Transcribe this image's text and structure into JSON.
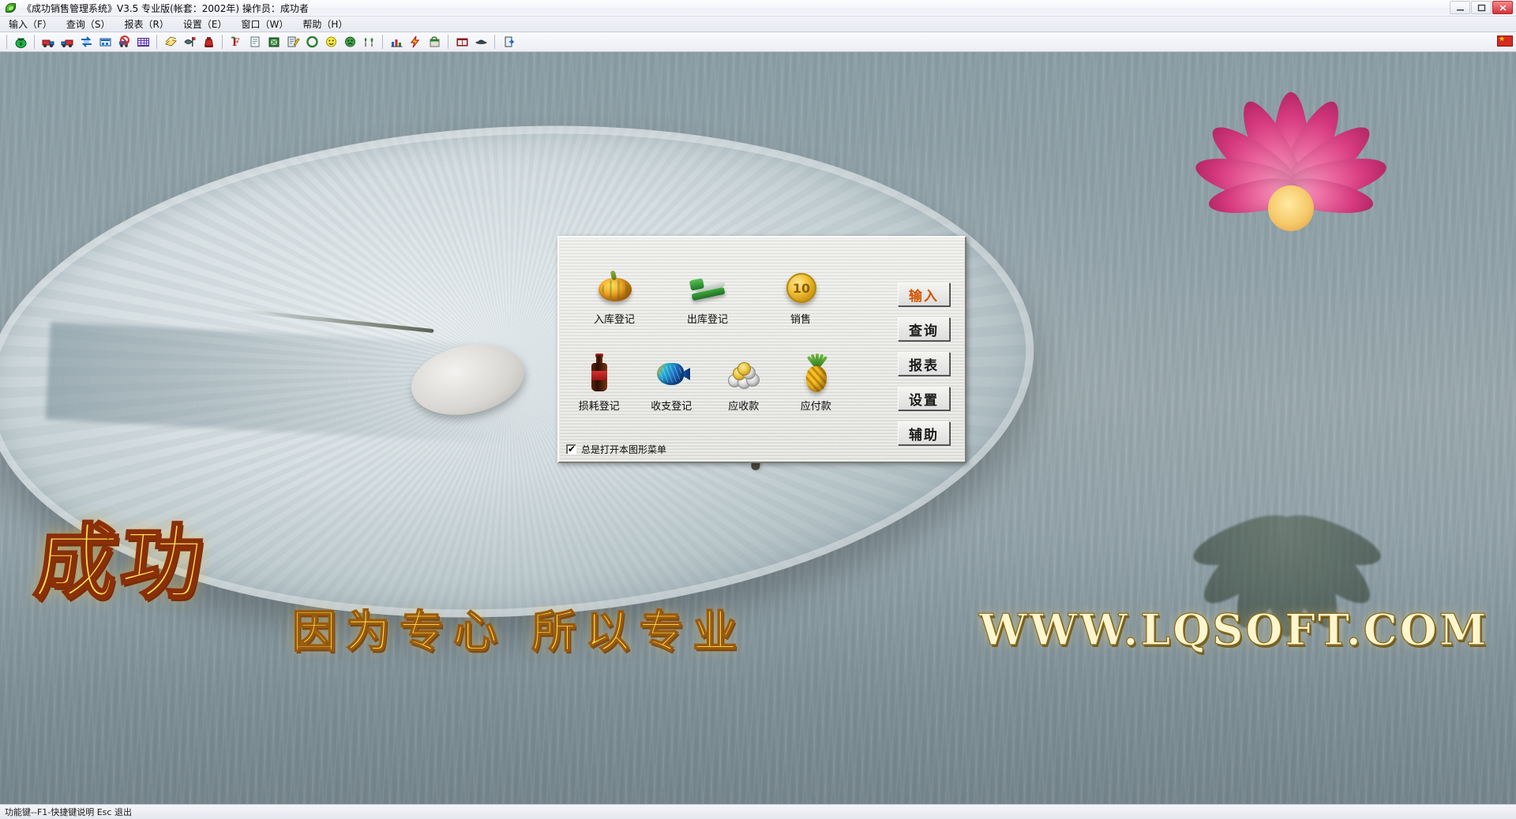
{
  "window": {
    "title": "《成功销售管理系统》V3.5 专业版(帐套：2002年) 操作员：成功者",
    "app_icon": "green-leaf-icon",
    "controls": {
      "minimize": "minimize-button",
      "maximize": "maximize-button",
      "close": "close-button"
    }
  },
  "menubar": {
    "items": [
      {
        "label": "输入（F）",
        "name": "menu-input"
      },
      {
        "label": "查询（S）",
        "name": "menu-query"
      },
      {
        "label": "报表（R）",
        "name": "menu-report"
      },
      {
        "label": "设置（E）",
        "name": "menu-settings"
      },
      {
        "label": "窗口（W）",
        "name": "menu-window"
      },
      {
        "label": "帮助（H）",
        "name": "menu-help"
      }
    ]
  },
  "toolbar": {
    "groups": [
      {
        "buttons": [
          {
            "icon": "money-bag-icon"
          }
        ]
      },
      {
        "buttons": [
          {
            "icon": "truck-in-icon"
          },
          {
            "icon": "truck-out-icon"
          },
          {
            "icon": "exchange-icon"
          },
          {
            "icon": "building-icon"
          },
          {
            "icon": "no-car-icon"
          },
          {
            "icon": "grid-table-icon"
          }
        ]
      },
      {
        "buttons": [
          {
            "icon": "paper-stack-icon"
          },
          {
            "icon": "fish-flag-icon"
          },
          {
            "icon": "red-vase-icon"
          }
        ]
      },
      {
        "buttons": [
          {
            "icon": "f-letter-icon"
          },
          {
            "icon": "document-icon"
          },
          {
            "icon": "green-book-icon"
          },
          {
            "icon": "edit-note-icon"
          },
          {
            "icon": "recycle-icon"
          },
          {
            "icon": "smiley-yellow-icon"
          },
          {
            "icon": "smiley-green-icon"
          },
          {
            "icon": "two-trees-icon"
          }
        ]
      },
      {
        "buttons": [
          {
            "icon": "bar-chart-icon"
          },
          {
            "icon": "lightning-icon"
          },
          {
            "icon": "shopping-bag-icon"
          }
        ]
      },
      {
        "buttons": [
          {
            "icon": "cabinet-icon"
          },
          {
            "icon": "hat-icon"
          }
        ]
      },
      {
        "buttons": [
          {
            "icon": "exit-door-icon"
          }
        ]
      }
    ],
    "right_flag": "china-flag-icon"
  },
  "graphic_menu": {
    "title": "graphic-menu-dialog",
    "items": [
      {
        "label": "入库登记",
        "art": "pumpkin-icon",
        "name": "menu-item-inbound-register"
      },
      {
        "label": "出库登记",
        "art": "stapler-icon",
        "name": "menu-item-outbound-register"
      },
      {
        "label": "销售",
        "art": "gold-coin-icon",
        "name": "menu-item-sales"
      },
      {
        "label": "损耗登记",
        "art": "cola-bottle-icon",
        "name": "menu-item-loss-register"
      },
      {
        "label": "收支登记",
        "art": "tropical-fish-icon",
        "name": "menu-item-income-expense-register"
      },
      {
        "label": "应收款",
        "art": "silver-coins-icon",
        "name": "menu-item-receivables"
      },
      {
        "label": "应付款",
        "art": "pineapple-icon",
        "name": "menu-item-payables"
      }
    ],
    "coin_face": "10",
    "side_buttons": [
      {
        "label": "输入",
        "name": "side-button-input",
        "active": true
      },
      {
        "label": "查询",
        "name": "side-button-query",
        "active": false
      },
      {
        "label": "报表",
        "name": "side-button-report",
        "active": false
      },
      {
        "label": "设置",
        "name": "side-button-settings",
        "active": false
      },
      {
        "label": "辅助",
        "name": "side-button-assist",
        "active": false
      }
    ],
    "checkbox": {
      "label": "总是打开本图形菜单",
      "checked": true
    }
  },
  "wallpaper": {
    "brand_logo_text": "成功",
    "slogan": "因为专心  所以专业",
    "url": "WWW.LQSOFT.COM"
  },
  "statusbar": {
    "text": "功能键--F1-快捷键说明  Esc 退出"
  },
  "colors": {
    "accent_orange": "#d35400",
    "brand_yellow": "#ffe24e",
    "dialog_face": "#e9e9e6",
    "water_blue_gray": "#93a3aa"
  }
}
